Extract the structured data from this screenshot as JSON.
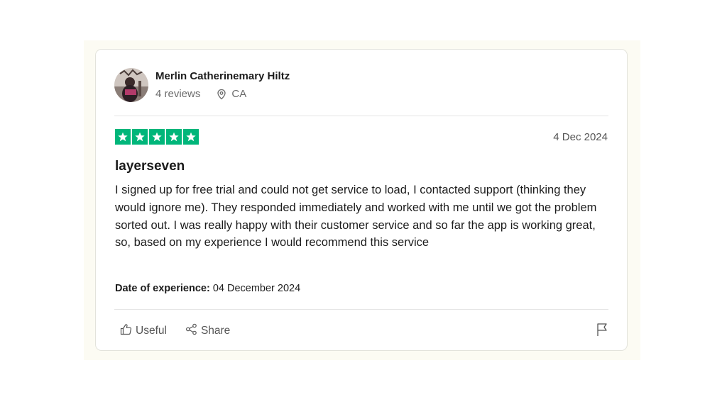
{
  "reviewer": {
    "name": "Merlin Catherinemary Hiltz",
    "reviews": "4 reviews",
    "location": "CA",
    "avatar_icon": "reviewer-avatar"
  },
  "review": {
    "rating": 5,
    "rating_max": 5,
    "date": "4 Dec 2024",
    "title": "layerseven",
    "body": "I signed up for free trial and could not get service to load, I contacted support (thinking they would ignore me). They responded immediately and worked with me until we got the problem sorted out. I was really happy with their customer service and so far the app is working great, so, based on my experience I would recommend this service",
    "experience_label": "Date of experience:",
    "experience_date": "04 December 2024"
  },
  "actions": {
    "useful_label": "Useful",
    "share_label": "Share"
  },
  "colors": {
    "star_green": "#00b67a",
    "frame_bg": "#fcfbf3"
  },
  "icons": [
    "location-pin-icon",
    "star-icon",
    "thumbs-up-icon",
    "share-icon",
    "flag-icon"
  ]
}
